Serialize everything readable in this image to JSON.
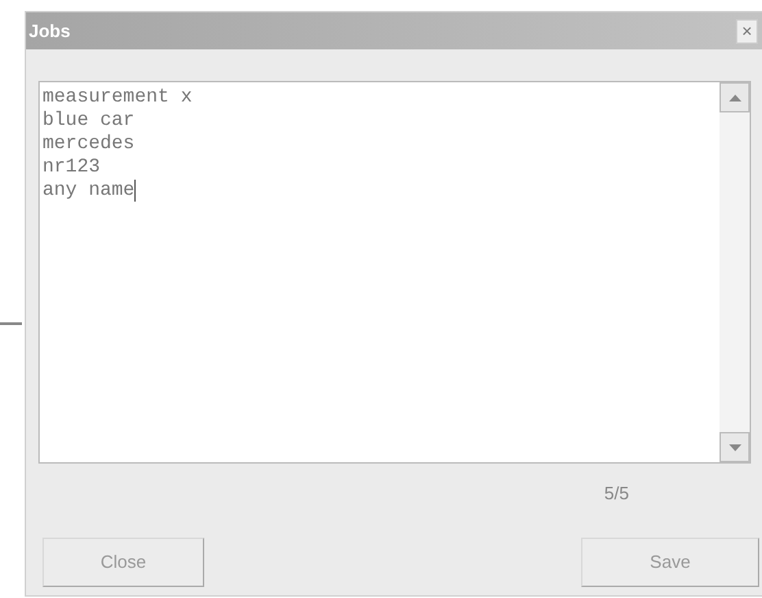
{
  "window": {
    "title": "Jobs",
    "close_glyph": "×"
  },
  "editor": {
    "lines": [
      "measurement x",
      "blue car",
      "mercedes",
      "nr123",
      "any name"
    ]
  },
  "counter": "5/5",
  "buttons": [
    {
      "label": "Close"
    },
    {
      "label": "Save"
    }
  ]
}
